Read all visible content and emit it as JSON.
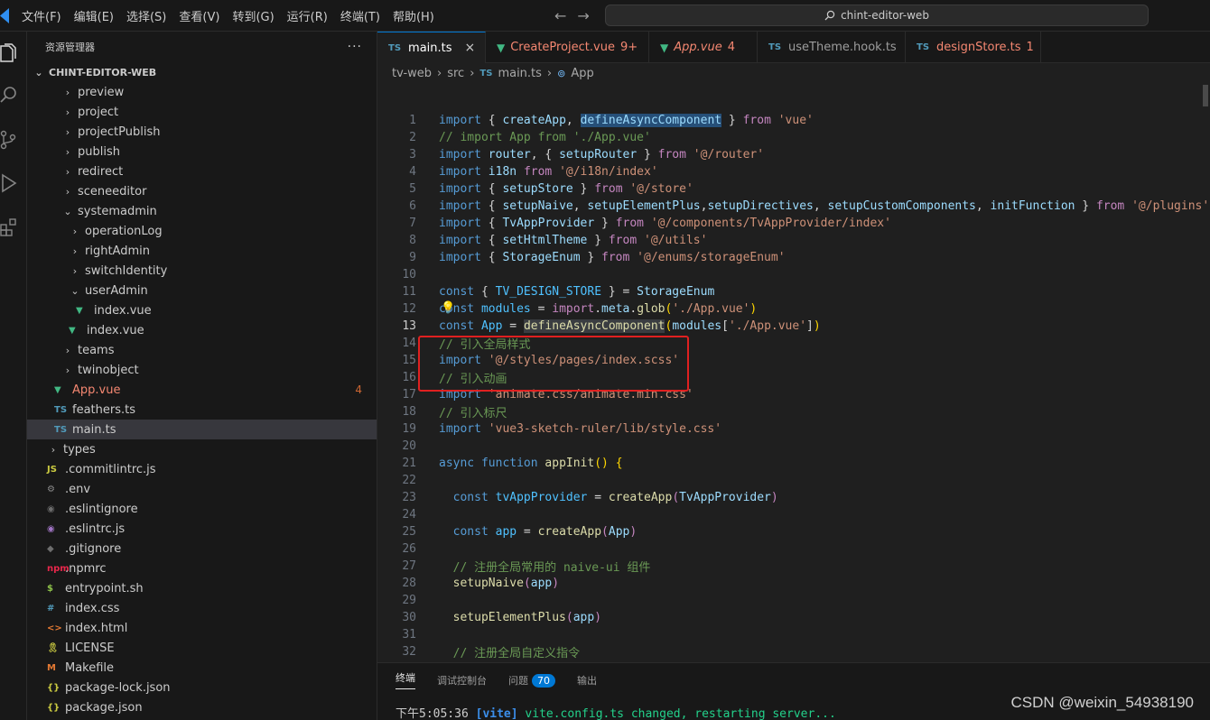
{
  "menu": [
    "文件(F)",
    "编辑(E)",
    "选择(S)",
    "查看(V)",
    "转到(G)",
    "运行(R)",
    "终端(T)",
    "帮助(H)"
  ],
  "search": {
    "icon": "search-icon",
    "text": "chint-editor-web"
  },
  "nav": {
    "back": "←",
    "forward": "→"
  },
  "activity": [
    "explorer-icon",
    "search-icon",
    "source-control-icon",
    "run-debug-icon",
    "extensions-icon"
  ],
  "sidebar": {
    "title": "资源管理器",
    "more": "···",
    "root": "CHINT-EDITOR-WEB",
    "items": [
      {
        "label": "preview",
        "kind": "folder",
        "depth": 2,
        "open": false
      },
      {
        "label": "project",
        "kind": "folder",
        "depth": 2,
        "open": false
      },
      {
        "label": "projectPublish",
        "kind": "folder",
        "depth": 2,
        "open": false
      },
      {
        "label": "publish",
        "kind": "folder",
        "depth": 2,
        "open": false
      },
      {
        "label": "redirect",
        "kind": "folder",
        "depth": 2,
        "open": false
      },
      {
        "label": "sceneeditor",
        "kind": "folder",
        "depth": 2,
        "open": false
      },
      {
        "label": "systemadmin",
        "kind": "folder",
        "depth": 2,
        "open": true
      },
      {
        "label": "operationLog",
        "kind": "folder",
        "depth": 3,
        "open": false
      },
      {
        "label": "rightAdmin",
        "kind": "folder",
        "depth": 3,
        "open": false
      },
      {
        "label": "switchIdentity",
        "kind": "folder",
        "depth": 3,
        "open": false
      },
      {
        "label": "userAdmin",
        "kind": "folder",
        "depth": 3,
        "open": true
      },
      {
        "label": "index.vue",
        "kind": "vue",
        "depth": 4
      },
      {
        "label": "index.vue",
        "kind": "vue",
        "depth": 3
      },
      {
        "label": "teams",
        "kind": "folder",
        "depth": 2,
        "open": false
      },
      {
        "label": "twinobject",
        "kind": "folder",
        "depth": 2,
        "open": false
      },
      {
        "label": "App.vue",
        "kind": "vue",
        "depth": 1,
        "status": "4",
        "error": true
      },
      {
        "label": "feathers.ts",
        "kind": "ts",
        "depth": 1
      },
      {
        "label": "main.ts",
        "kind": "ts",
        "depth": 1,
        "selected": true
      },
      {
        "label": "types",
        "kind": "folder",
        "depth": 0,
        "open": false
      },
      {
        "label": ".commitlintrc.js",
        "kind": "js",
        "depth": 0
      },
      {
        "label": ".env",
        "kind": "gear",
        "depth": 0
      },
      {
        "label": ".eslintignore",
        "kind": "circle",
        "depth": 0
      },
      {
        "label": ".eslintrc.js",
        "kind": "eslint",
        "depth": 0
      },
      {
        "label": ".gitignore",
        "kind": "git",
        "depth": 0
      },
      {
        "label": ".npmrc",
        "kind": "npm",
        "depth": 0
      },
      {
        "label": "entrypoint.sh",
        "kind": "sh",
        "depth": 0
      },
      {
        "label": "index.css",
        "kind": "css",
        "depth": 0
      },
      {
        "label": "index.html",
        "kind": "html",
        "depth": 0
      },
      {
        "label": "LICENSE",
        "kind": "license",
        "depth": 0
      },
      {
        "label": "Makefile",
        "kind": "make",
        "depth": 0
      },
      {
        "label": "package-lock.json",
        "kind": "json",
        "depth": 0
      },
      {
        "label": "package.json",
        "kind": "json",
        "depth": 0
      }
    ]
  },
  "tabs": [
    {
      "label": "main.ts",
      "icon": "TS",
      "active": true,
      "close": "×"
    },
    {
      "label": "CreateProject.vue",
      "icon": "V",
      "count": "9+"
    },
    {
      "label": "App.vue",
      "icon": "V",
      "count": "4"
    },
    {
      "label": "useTheme.hook.ts",
      "icon": "TS"
    },
    {
      "label": "designStore.ts",
      "icon": "TS",
      "count": "1"
    }
  ],
  "breadcrumb": {
    "p1": "tv-web",
    "p2": "src",
    "file_icon": "TS",
    "p3": "main.ts",
    "p4": "App"
  },
  "code": [
    {
      "n": "1",
      "t": [
        [
          "kw",
          "import"
        ],
        [
          "pl",
          " { "
        ],
        [
          "var",
          "createApp"
        ],
        [
          "pl",
          ", "
        ],
        [
          "var hl",
          "defineAsyncComponent"
        ],
        [
          "pl",
          " } "
        ],
        [
          "kw2",
          "from"
        ],
        [
          "pl",
          " "
        ],
        [
          "str",
          "'vue'"
        ]
      ]
    },
    {
      "n": "2",
      "t": [
        [
          "cm",
          "// import App from './App.vue'"
        ]
      ]
    },
    {
      "n": "3",
      "t": [
        [
          "kw",
          "import"
        ],
        [
          "pl",
          " "
        ],
        [
          "var",
          "router"
        ],
        [
          "pl",
          ", { "
        ],
        [
          "var",
          "setupRouter"
        ],
        [
          "pl",
          " } "
        ],
        [
          "kw2",
          "from"
        ],
        [
          "pl",
          " "
        ],
        [
          "str",
          "'@/router'"
        ]
      ]
    },
    {
      "n": "4",
      "t": [
        [
          "kw",
          "import"
        ],
        [
          "pl",
          " "
        ],
        [
          "var",
          "i18n"
        ],
        [
          "pl",
          " "
        ],
        [
          "kw2",
          "from"
        ],
        [
          "pl",
          " "
        ],
        [
          "str",
          "'@/i18n/index'"
        ]
      ]
    },
    {
      "n": "5",
      "t": [
        [
          "kw",
          "import"
        ],
        [
          "pl",
          " { "
        ],
        [
          "var",
          "setupStore"
        ],
        [
          "pl",
          " } "
        ],
        [
          "kw2",
          "from"
        ],
        [
          "pl",
          " "
        ],
        [
          "str",
          "'@/store'"
        ]
      ]
    },
    {
      "n": "6",
      "t": [
        [
          "kw",
          "import"
        ],
        [
          "pl",
          " { "
        ],
        [
          "var",
          "setupNaive"
        ],
        [
          "pl",
          ", "
        ],
        [
          "var",
          "setupElementPlus"
        ],
        [
          "pl",
          ","
        ],
        [
          "var",
          "setupDirectives"
        ],
        [
          "pl",
          ", "
        ],
        [
          "var",
          "setupCustomComponents"
        ],
        [
          "pl",
          ", "
        ],
        [
          "var",
          "initFunction"
        ],
        [
          "pl",
          " } "
        ],
        [
          "kw2",
          "from"
        ],
        [
          "pl",
          " "
        ],
        [
          "str",
          "'@/plugins'"
        ]
      ]
    },
    {
      "n": "7",
      "t": [
        [
          "kw",
          "import"
        ],
        [
          "pl",
          " { "
        ],
        [
          "var",
          "TvAppProvider"
        ],
        [
          "pl",
          " } "
        ],
        [
          "kw2",
          "from"
        ],
        [
          "pl",
          " "
        ],
        [
          "str",
          "'@/components/TvAppProvider/index'"
        ]
      ]
    },
    {
      "n": "8",
      "t": [
        [
          "kw",
          "import"
        ],
        [
          "pl",
          " { "
        ],
        [
          "var",
          "setHtmlTheme"
        ],
        [
          "pl",
          " } "
        ],
        [
          "kw2",
          "from"
        ],
        [
          "pl",
          " "
        ],
        [
          "str",
          "'@/utils'"
        ]
      ]
    },
    {
      "n": "9",
      "t": [
        [
          "kw",
          "import"
        ],
        [
          "pl",
          " { "
        ],
        [
          "var",
          "StorageEnum"
        ],
        [
          "pl",
          " } "
        ],
        [
          "kw2",
          "from"
        ],
        [
          "pl",
          " "
        ],
        [
          "str",
          "'@/enums/storageEnum'"
        ]
      ]
    },
    {
      "n": "10",
      "t": []
    },
    {
      "n": "11",
      "t": [
        [
          "kw",
          "const"
        ],
        [
          "pl",
          " { "
        ],
        [
          "const",
          "TV_DESIGN_STORE"
        ],
        [
          "pl",
          " } = "
        ],
        [
          "var",
          "StorageEnum"
        ]
      ]
    },
    {
      "n": "12",
      "t": [
        [
          "kw",
          "const"
        ],
        [
          "pl",
          " "
        ],
        [
          "const",
          "modules"
        ],
        [
          "pl",
          " = "
        ],
        [
          "kw2",
          "import"
        ],
        [
          "pl",
          "."
        ],
        [
          "var",
          "meta"
        ],
        [
          "pl",
          "."
        ],
        [
          "fn",
          "glob"
        ],
        [
          "br",
          "("
        ],
        [
          "str",
          "'./App.vue'"
        ],
        [
          "br",
          ")"
        ]
      ]
    },
    {
      "n": "13",
      "cur": true,
      "t": [
        [
          "kw",
          "const"
        ],
        [
          "pl",
          " "
        ],
        [
          "const",
          "App"
        ],
        [
          "pl",
          " = "
        ],
        [
          "fn hl2",
          "defineAsyncComponent"
        ],
        [
          "br",
          "("
        ],
        [
          "var",
          "modules"
        ],
        [
          "pl",
          "["
        ],
        [
          "str",
          "'./App.vue'"
        ],
        [
          "pl",
          "]"
        ],
        [
          "br",
          ")"
        ]
      ]
    },
    {
      "n": "14",
      "t": [
        [
          "cm",
          "// 引入全局样式"
        ]
      ]
    },
    {
      "n": "15",
      "t": [
        [
          "kw",
          "import"
        ],
        [
          "pl",
          " "
        ],
        [
          "str",
          "'@/styles/pages/index.scss'"
        ]
      ]
    },
    {
      "n": "16",
      "t": [
        [
          "cm",
          "// 引入动画"
        ]
      ]
    },
    {
      "n": "17",
      "t": [
        [
          "kw",
          "import"
        ],
        [
          "pl",
          " "
        ],
        [
          "str",
          "'animate.css/animate.min.css'"
        ]
      ]
    },
    {
      "n": "18",
      "t": [
        [
          "cm",
          "// 引入标尺"
        ]
      ]
    },
    {
      "n": "19",
      "t": [
        [
          "kw",
          "import"
        ],
        [
          "pl",
          " "
        ],
        [
          "str",
          "'vue3-sketch-ruler/lib/style.css'"
        ]
      ]
    },
    {
      "n": "20",
      "t": []
    },
    {
      "n": "21",
      "t": [
        [
          "kw",
          "async"
        ],
        [
          "pl",
          " "
        ],
        [
          "kw",
          "function"
        ],
        [
          "pl",
          " "
        ],
        [
          "fn",
          "appInit"
        ],
        [
          "br",
          "()"
        ],
        [
          "pl",
          " "
        ],
        [
          "br",
          "{"
        ]
      ]
    },
    {
      "n": "22",
      "t": []
    },
    {
      "n": "23",
      "t": [
        [
          "pl",
          "  "
        ],
        [
          "kw",
          "const"
        ],
        [
          "pl",
          " "
        ],
        [
          "const",
          "tvAppProvider"
        ],
        [
          "pl",
          " = "
        ],
        [
          "fn",
          "createApp"
        ],
        [
          "kw2",
          "("
        ],
        [
          "var",
          "TvAppProvider"
        ],
        [
          "kw2",
          ")"
        ]
      ]
    },
    {
      "n": "24",
      "t": []
    },
    {
      "n": "25",
      "t": [
        [
          "pl",
          "  "
        ],
        [
          "kw",
          "const"
        ],
        [
          "pl",
          " "
        ],
        [
          "const",
          "app"
        ],
        [
          "pl",
          " = "
        ],
        [
          "fn",
          "createApp"
        ],
        [
          "kw2",
          "("
        ],
        [
          "var",
          "App"
        ],
        [
          "kw2",
          ")"
        ]
      ]
    },
    {
      "n": "26",
      "t": []
    },
    {
      "n": "27",
      "t": [
        [
          "pl",
          "  "
        ],
        [
          "cm",
          "// 注册全局常用的 naive-ui 组件"
        ]
      ]
    },
    {
      "n": "28",
      "t": [
        [
          "pl",
          "  "
        ],
        [
          "fn",
          "setupNaive"
        ],
        [
          "kw2",
          "("
        ],
        [
          "var",
          "app"
        ],
        [
          "kw2",
          ")"
        ]
      ]
    },
    {
      "n": "29",
      "t": []
    },
    {
      "n": "30",
      "t": [
        [
          "pl",
          "  "
        ],
        [
          "fn",
          "setupElementPlus"
        ],
        [
          "kw2",
          "("
        ],
        [
          "var",
          "app"
        ],
        [
          "kw2",
          ")"
        ]
      ]
    },
    {
      "n": "31",
      "t": []
    },
    {
      "n": "32",
      "t": [
        [
          "pl",
          "  "
        ],
        [
          "cm",
          "// 注册全局自定义指令"
        ]
      ]
    }
  ],
  "panel": {
    "tabs": [
      "终端",
      "调试控制台",
      "问题",
      "输出"
    ],
    "problems_count": "70",
    "term_time": "下午5:05:36",
    "term_tag": "[vite]",
    "term_msg": "vite.config.ts changed, restarting server..."
  },
  "watermark": "CSDN @weixin_54938190"
}
